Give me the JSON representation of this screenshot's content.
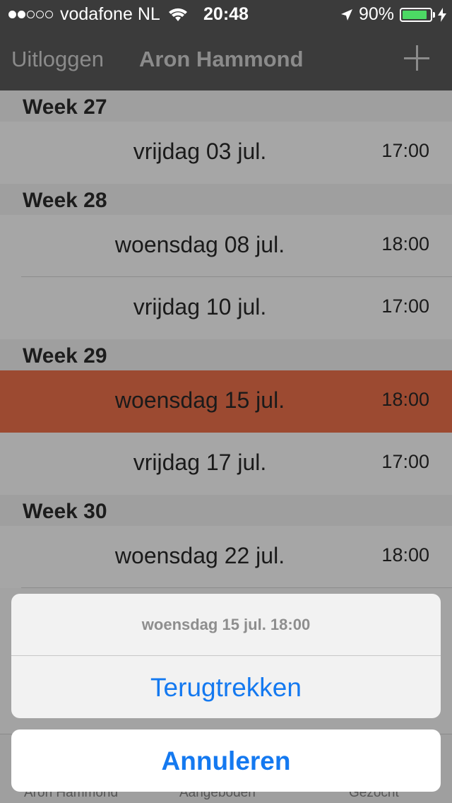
{
  "status_bar": {
    "carrier": "vodafone NL",
    "time": "20:48",
    "battery": "90%",
    "battery_level": 0.9,
    "signal_bars": 2,
    "signal_total": 5
  },
  "nav": {
    "left_button": "Uitloggen",
    "title": "Aron Hammond"
  },
  "sections": [
    {
      "header": "Week 27",
      "rows": [
        {
          "date": "vrijdag 03 jul.",
          "time": "17:00"
        }
      ]
    },
    {
      "header": "Week 28",
      "rows": [
        {
          "date": "woensdag 08 jul.",
          "time": "18:00"
        },
        {
          "date": "vrijdag 10 jul.",
          "time": "17:00"
        }
      ]
    },
    {
      "header": "Week 29",
      "rows": [
        {
          "date": "woensdag 15 jul.",
          "time": "18:00"
        },
        {
          "date": "vrijdag 17 jul.",
          "time": "17:00"
        }
      ]
    },
    {
      "header": "Week 30",
      "rows": [
        {
          "date": "woensdag 22 jul.",
          "time": "18:00"
        }
      ]
    }
  ],
  "tabs": [
    "Aron Hammond",
    "Aangeboden",
    "Gezocht"
  ],
  "action_sheet": {
    "title": "woensdag 15 jul. 18:00",
    "action": "Terugtrekken",
    "cancel": "Annuleren"
  },
  "colors": {
    "selected_row": "#9c4a31",
    "action_blue": "#1479f0",
    "battery_green": "#4cd964"
  }
}
